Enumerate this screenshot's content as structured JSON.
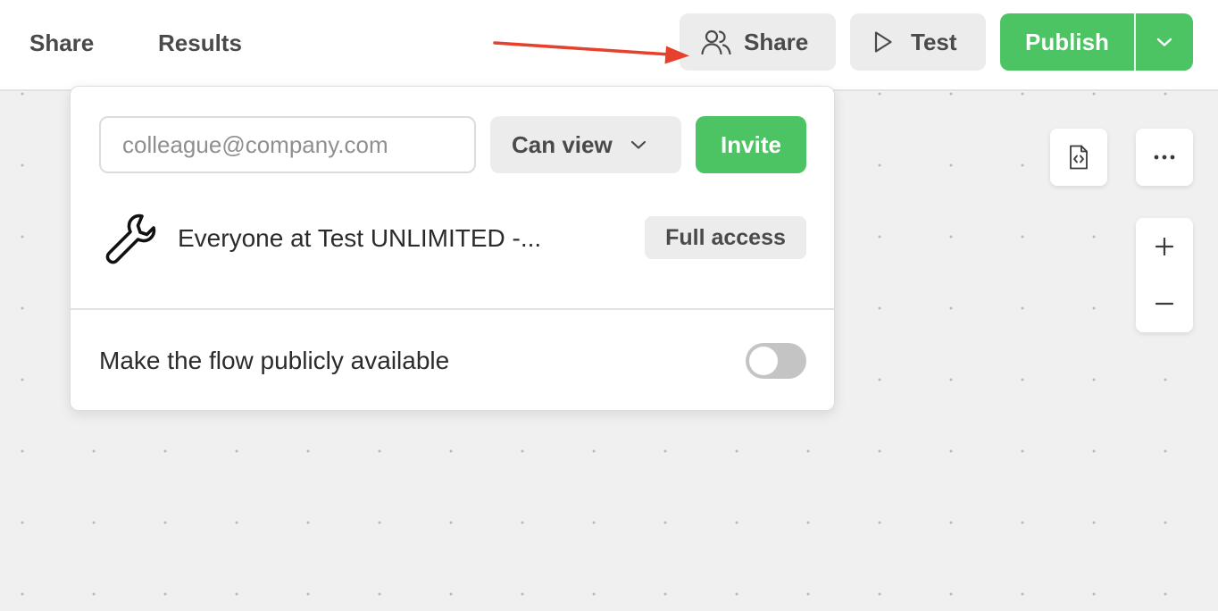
{
  "nav": {
    "tabs": [
      {
        "label": "Share"
      },
      {
        "label": "Results"
      }
    ]
  },
  "toolbar": {
    "share_label": "Share",
    "test_label": "Test",
    "publish_label": "Publish"
  },
  "share_popover": {
    "email_placeholder": "colleague@company.com",
    "email_value": "",
    "role_selected": "Can view",
    "invite_label": "Invite",
    "member": {
      "icon": "wrench-icon",
      "name": "Everyone at Test UNLIMITED -...",
      "access": "Full access"
    },
    "public_label": "Make the flow publicly available",
    "public_enabled": false
  },
  "canvas": {
    "icons": [
      "code-file-icon",
      "more-icon",
      "zoom-in-icon",
      "zoom-out-icon"
    ]
  },
  "colors": {
    "accent_green": "#4cc463",
    "annotation_arrow": "#e5412d"
  }
}
